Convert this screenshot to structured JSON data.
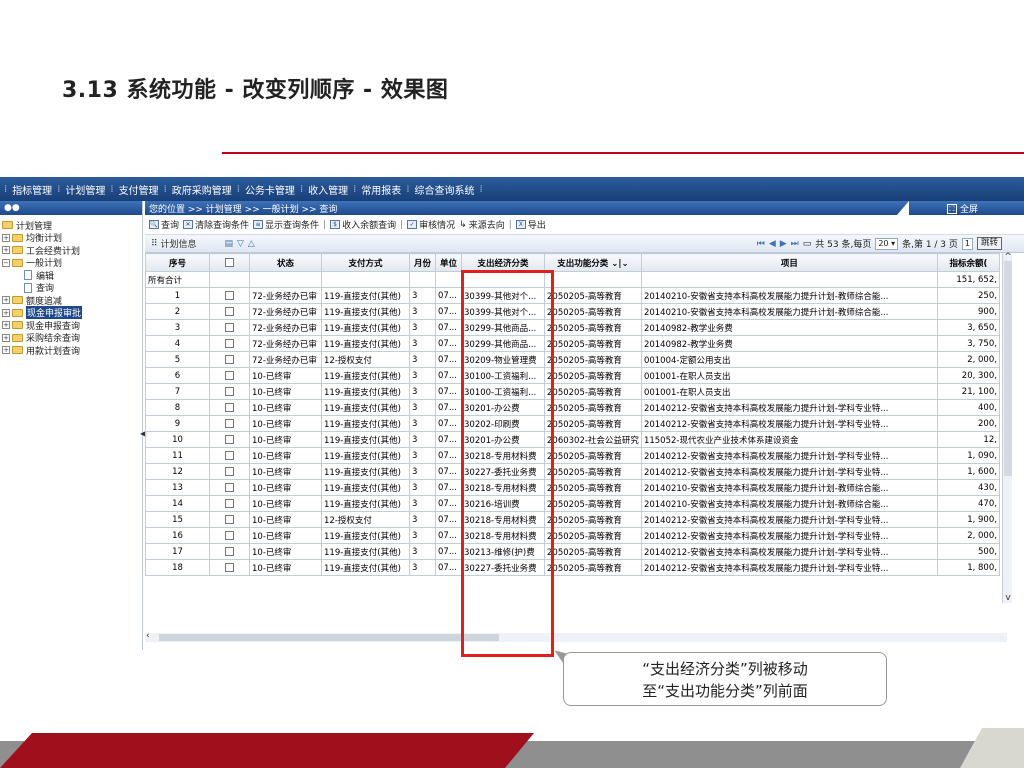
{
  "slide": {
    "title": "3.13  系统功能 - 改变列顺序 - 效果图",
    "callout_line1": "“支出经济分类”列被移动",
    "callout_line2": "至“支出功能分类”列前面"
  },
  "menubar": [
    "指标管理",
    "计划管理",
    "支付管理",
    "政府采购管理",
    "公务卡管理",
    "收入管理",
    "常用报表",
    "综合查询系统"
  ],
  "sidebar": {
    "root": "计划管理",
    "items": [
      {
        "label": "均衡计划",
        "type": "folder"
      },
      {
        "label": "工会经费计划",
        "type": "folder"
      },
      {
        "label": "一般计划",
        "type": "folder-open"
      },
      {
        "label": "编辑",
        "type": "doc"
      },
      {
        "label": "查询",
        "type": "doc"
      },
      {
        "label": "额度追减",
        "type": "folder"
      },
      {
        "label": "现金申报审批",
        "type": "folder"
      },
      {
        "label": "现金申报查询",
        "type": "folder"
      },
      {
        "label": "采购结余查询",
        "type": "folder"
      },
      {
        "label": "用款计划查询",
        "type": "folder"
      }
    ]
  },
  "breadcrumb": "您的位置 >> 计划管理 >> 一般计划 >> 查询",
  "fullscreen_label": "全屏",
  "toolbar": {
    "query": "查询",
    "clear_condition": "清除查询条件",
    "show_condition": "显示查询条件",
    "balance_query": "收入余额查询",
    "audit": "审核情况",
    "source": "来源去向",
    "export": "导出"
  },
  "gridbar": {
    "label": "计划信息",
    "total_text": "共 53 条,每页",
    "page_size": "20",
    "page_text": "条,第 1 / 3 页",
    "page_input": "1",
    "jump_label": "跳转"
  },
  "table": {
    "columns": [
      "序号",
      "",
      "状态",
      "支付方式",
      "月份",
      "单位",
      "支出经济分类",
      "支出功能分类",
      "项目",
      "指标余额("
    ],
    "total_row": {
      "label": "所有合计",
      "amount": "151, 652,"
    },
    "rows": [
      [
        "1",
        "72-业务经办已审",
        "119-直接支付(其他)",
        "3",
        "07...",
        "30399-其他对个...",
        "2050205-高等教育",
        "20140210-安徽省支持本科高校发展能力提升计划-教师综合能...",
        "250,"
      ],
      [
        "2",
        "72-业务经办已审",
        "119-直接支付(其他)",
        "3",
        "07...",
        "30399-其他对个...",
        "2050205-高等教育",
        "20140210-安徽省支持本科高校发展能力提升计划-教师综合能...",
        "900,"
      ],
      [
        "3",
        "72-业务经办已审",
        "119-直接支付(其他)",
        "3",
        "07...",
        "30299-其他商品...",
        "2050205-高等教育",
        "20140982-教学业务费",
        "3, 650,"
      ],
      [
        "4",
        "72-业务经办已审",
        "119-直接支付(其他)",
        "3",
        "07...",
        "30299-其他商品...",
        "2050205-高等教育",
        "20140982-教学业务费",
        "3, 750,"
      ],
      [
        "5",
        "72-业务经办已审",
        "12-授权支付",
        "3",
        "07...",
        "30209-物业管理费",
        "2050205-高等教育",
        "001004-定额公用支出",
        "2, 000,"
      ],
      [
        "6",
        "10-已终审",
        "119-直接支付(其他)",
        "3",
        "07...",
        "30100-工资福利...",
        "2050205-高等教育",
        "001001-在职人员支出",
        "20, 300,"
      ],
      [
        "7",
        "10-已终审",
        "119-直接支付(其他)",
        "3",
        "07...",
        "30100-工资福利...",
        "2050205-高等教育",
        "001001-在职人员支出",
        "21, 100,"
      ],
      [
        "8",
        "10-已终审",
        "119-直接支付(其他)",
        "3",
        "07...",
        "30201-办公费",
        "2050205-高等教育",
        "20140212-安徽省支持本科高校发展能力提升计划-学科专业特...",
        "400,"
      ],
      [
        "9",
        "10-已终审",
        "119-直接支付(其他)",
        "3",
        "07...",
        "30202-印刷费",
        "2050205-高等教育",
        "20140212-安徽省支持本科高校发展能力提升计划-学科专业特...",
        "200,"
      ],
      [
        "10",
        "10-已终审",
        "119-直接支付(其他)",
        "3",
        "07...",
        "30201-办公费",
        "2060302-社会公益研究",
        "115052-现代农业产业技术体系建设资金",
        "12,"
      ],
      [
        "11",
        "10-已终审",
        "119-直接支付(其他)",
        "3",
        "07...",
        "30218-专用材料费",
        "2050205-高等教育",
        "20140212-安徽省支持本科高校发展能力提升计划-学科专业特...",
        "1, 090,"
      ],
      [
        "12",
        "10-已终审",
        "119-直接支付(其他)",
        "3",
        "07...",
        "30227-委托业务费",
        "2050205-高等教育",
        "20140212-安徽省支持本科高校发展能力提升计划-学科专业特...",
        "1, 600,"
      ],
      [
        "13",
        "10-已终审",
        "119-直接支付(其他)",
        "3",
        "07...",
        "30218-专用材料费",
        "2050205-高等教育",
        "20140210-安徽省支持本科高校发展能力提升计划-教师综合能...",
        "430,"
      ],
      [
        "14",
        "10-已终审",
        "119-直接支付(其他)",
        "3",
        "07...",
        "30216-培训费",
        "2050205-高等教育",
        "20140210-安徽省支持本科高校发展能力提升计划-教师综合能...",
        "470,"
      ],
      [
        "15",
        "10-已终审",
        "12-授权支付",
        "3",
        "07...",
        "30218-专用材料费",
        "2050205-高等教育",
        "20140212-安徽省支持本科高校发展能力提升计划-学科专业特...",
        "1, 900,"
      ],
      [
        "16",
        "10-已终审",
        "119-直接支付(其他)",
        "3",
        "07...",
        "30218-专用材料费",
        "2050205-高等教育",
        "20140212-安徽省支持本科高校发展能力提升计划-学科专业特...",
        "2, 000,"
      ],
      [
        "17",
        "10-已终审",
        "119-直接支付(其他)",
        "3",
        "07...",
        "30213-维修(护)费",
        "2050205-高等教育",
        "20140212-安徽省支持本科高校发展能力提升计划-学科专业特...",
        "500,"
      ],
      [
        "18",
        "10-已终审",
        "119-直接支付(其他)",
        "3",
        "07...",
        "30227-委托业务费",
        "2050205-高等教育",
        "20140212-安徽省支持本科高校发展能力提升计划-学科专业特...",
        "1, 800,"
      ]
    ]
  }
}
